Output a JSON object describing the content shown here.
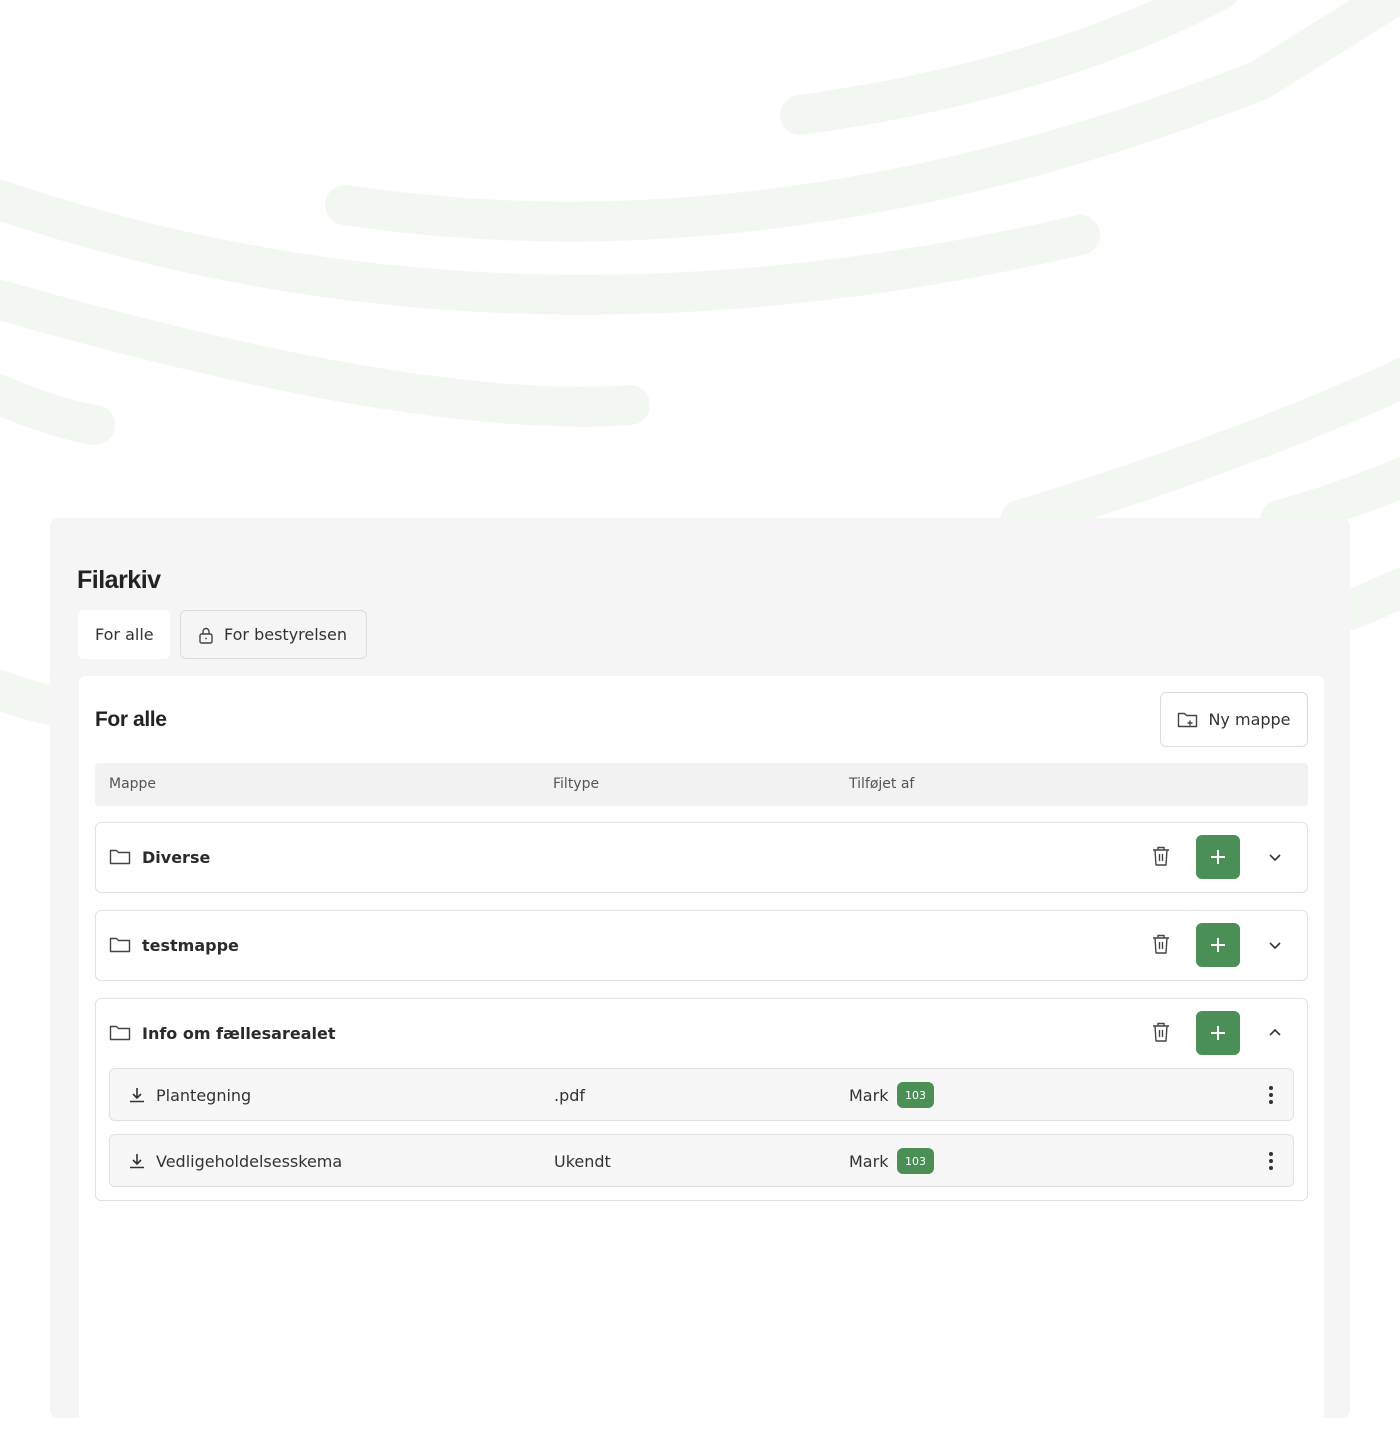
{
  "page": {
    "title": "Filarkiv"
  },
  "tabs": {
    "all_label": "For alle",
    "board_label": "For bestyrelsen",
    "board_icon": "lock-icon"
  },
  "section": {
    "title": "For alle",
    "new_folder_label": "Ny mappe",
    "new_folder_icon": "folder-plus-icon"
  },
  "table": {
    "headers": {
      "folder": "Mappe",
      "filetype": "Filtype",
      "added_by": "Tilføjet af"
    }
  },
  "folders": [
    {
      "name": "Diverse",
      "expanded": false
    },
    {
      "name": "testmappe",
      "expanded": false
    },
    {
      "name": "Info om fællesarealet",
      "expanded": true
    }
  ],
  "files": [
    {
      "name": "Plantegning",
      "type": ".pdf",
      "user": "Mark",
      "unit": "103"
    },
    {
      "name": "Vedligeholdelsesskema",
      "type": "Ukendt",
      "user": "Mark",
      "unit": "103"
    }
  ],
  "colors": {
    "accent": "#4a8f55",
    "panel": "#f5f5f5",
    "deco": "#f4f8f2"
  }
}
